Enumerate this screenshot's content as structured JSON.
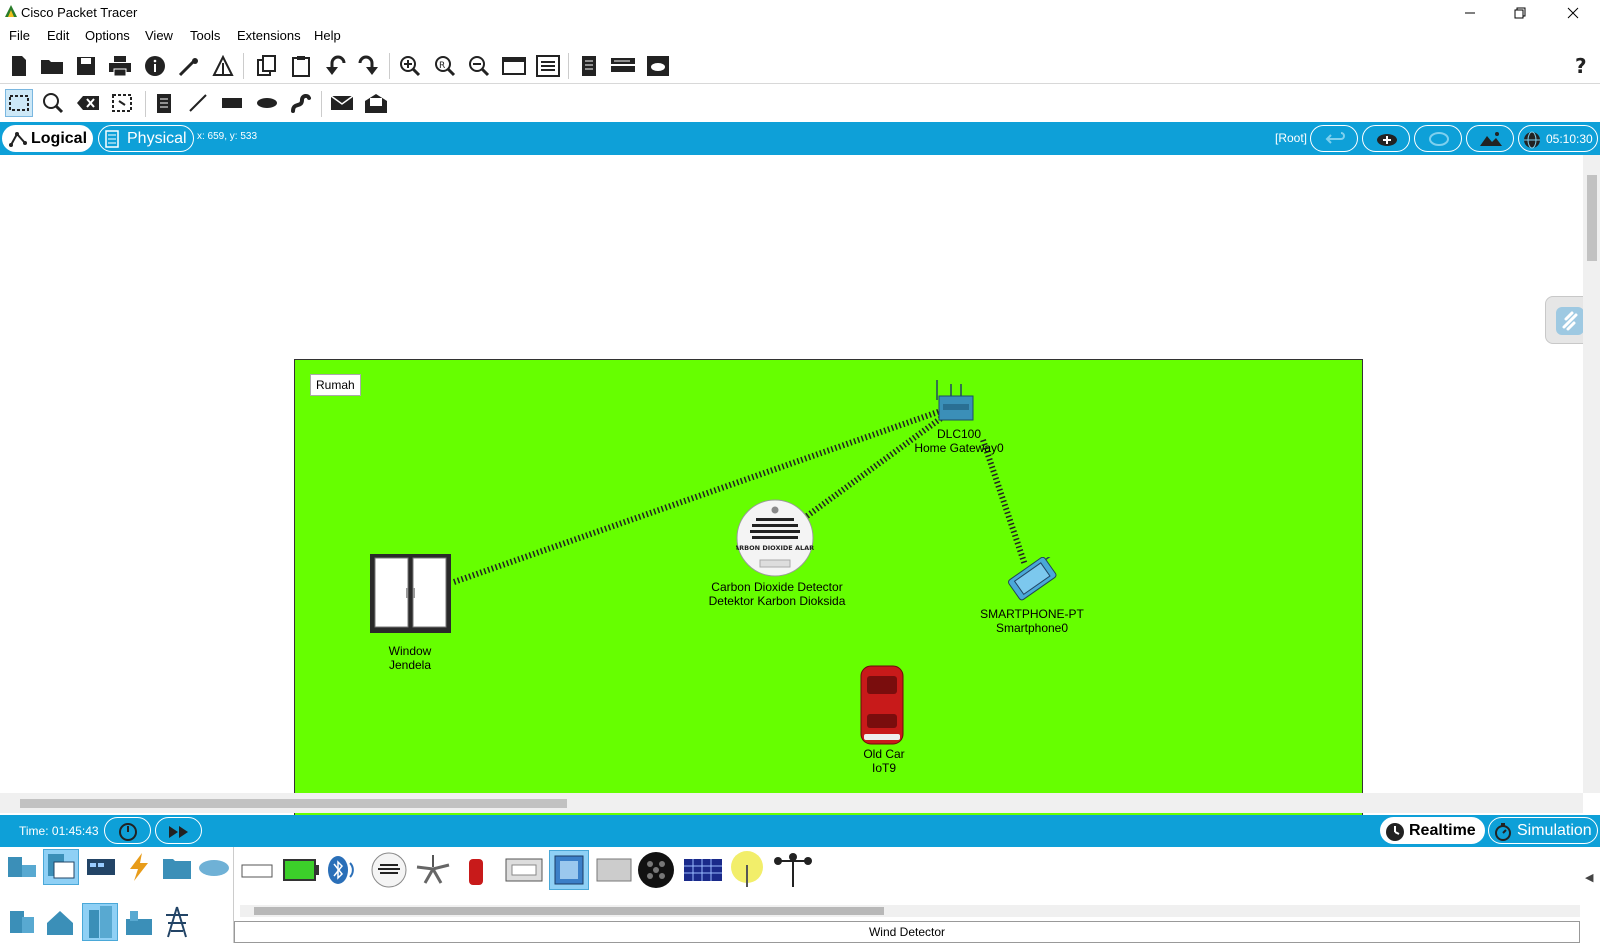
{
  "window": {
    "title": "Cisco Packet Tracer"
  },
  "menu": [
    "File",
    "Edit",
    "Options",
    "View",
    "Tools",
    "Extensions",
    "Help"
  ],
  "modebar": {
    "logical": "Logical",
    "physical": "Physical",
    "coords": "x: 659, y: 533",
    "root": "[Root]",
    "clock": "05:10:30"
  },
  "canvas": {
    "cluster_label": "Rumah",
    "devices": [
      {
        "name": "DLC100",
        "label": "Home Gateway0",
        "icon": "home-gateway-icon"
      },
      {
        "name": "Carbon Dioxide Detector",
        "label": "Detektor Karbon Dioksida",
        "icon": "co2-alarm-icon",
        "alarm_text": "CARBON DIOXIDE ALARM"
      },
      {
        "name": "Window",
        "label": "Jendela",
        "icon": "window-icon"
      },
      {
        "name": "SMARTPHONE-PT",
        "label": "Smartphone0",
        "icon": "smartphone-icon"
      },
      {
        "name": "Old Car",
        "label": "IoT9",
        "icon": "car-icon"
      }
    ]
  },
  "bottom": {
    "time": "Time: 01:45:43",
    "realtime": "Realtime",
    "simulation": "Simulation",
    "selected_device": "Wind Detector"
  },
  "colors": {
    "accent": "#0ea0d8",
    "canvas_green": "#66ff00"
  }
}
